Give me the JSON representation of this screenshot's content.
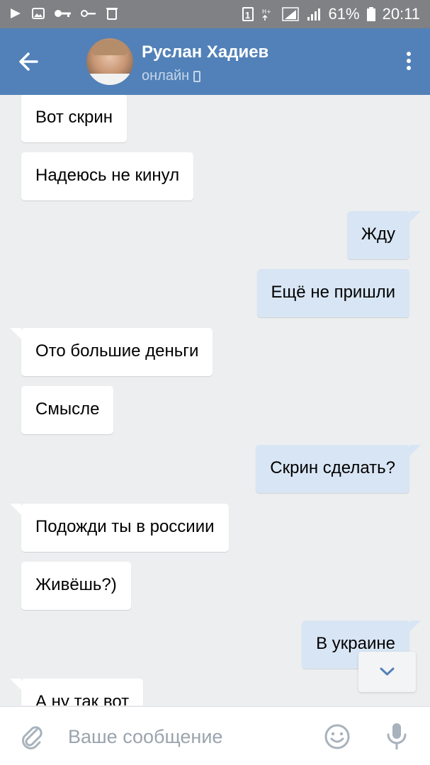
{
  "status_bar": {
    "battery": "61%",
    "time": "20:11",
    "sim_badge": "1"
  },
  "header": {
    "contact_name": "Руслан Хадиев",
    "status": "онлайн"
  },
  "messages": [
    {
      "direction": "in",
      "text": "Вот скрин"
    },
    {
      "direction": "in",
      "text": "Надеюсь не кинул"
    },
    {
      "direction": "out",
      "text": "Жду"
    },
    {
      "direction": "out",
      "text": "Ещё не пришли"
    },
    {
      "direction": "in",
      "text": "Ото большие деньги"
    },
    {
      "direction": "in",
      "text": "Смысле"
    },
    {
      "direction": "out",
      "text": "Скрин сделать?"
    },
    {
      "direction": "in",
      "text": "Подожди ты в россиии"
    },
    {
      "direction": "in",
      "text": "Живёшь?)"
    },
    {
      "direction": "out",
      "text": "В украине"
    },
    {
      "direction": "in",
      "text": "А ну так вот"
    }
  ],
  "composer": {
    "placeholder": "Ваше сообщение"
  },
  "colors": {
    "header": "#5181b8",
    "incoming_bubble": "#ffffff",
    "outgoing_bubble": "#d8e5f4",
    "background": "#edeef0"
  },
  "icons": [
    "back-arrow-icon",
    "more-vertical-icon",
    "paperclip-icon",
    "emoji-icon",
    "microphone-icon",
    "chevron-down-icon",
    "phone-icon"
  ]
}
